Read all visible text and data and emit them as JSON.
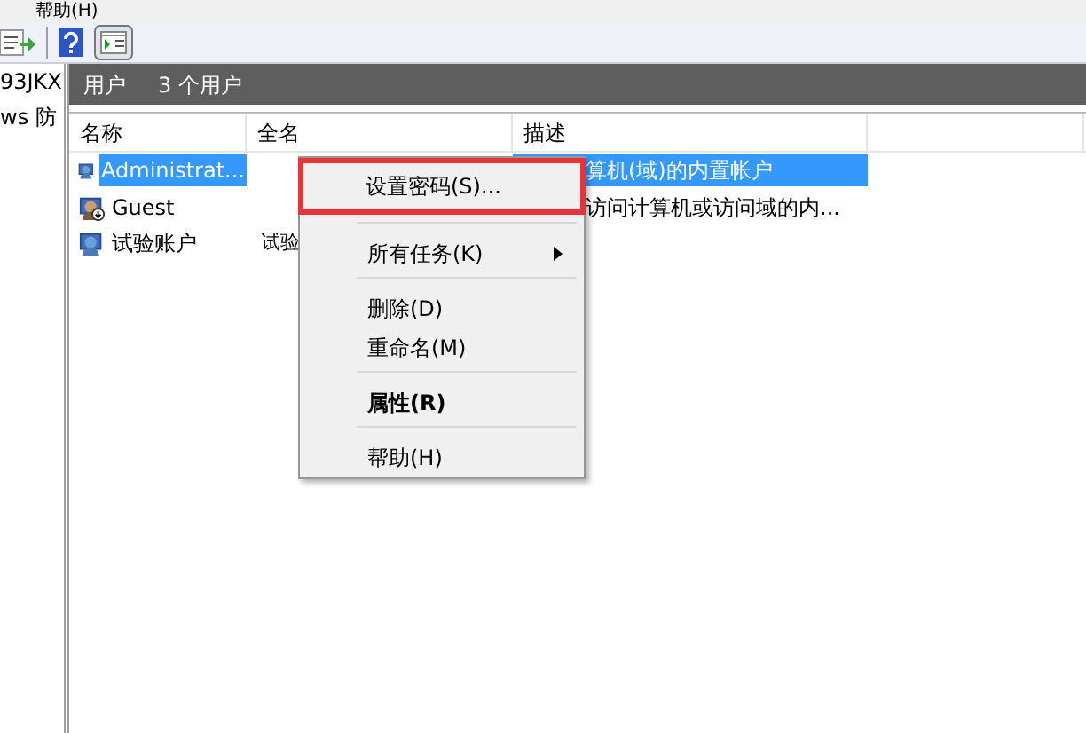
{
  "menu_bar": {
    "items": [
      "帮助(H)"
    ]
  },
  "left_pane": {
    "items": [
      "93JKX",
      "ws 防"
    ]
  },
  "header": {
    "title": "用户",
    "count": "3 个用户"
  },
  "table": {
    "columns": [
      "名称",
      "全名",
      "描述"
    ],
    "rows": [
      {
        "name": "Administrat...",
        "full_name": "",
        "description": "算机(域)的内置帐户",
        "selected": true,
        "kind": "user"
      },
      {
        "name": "Guest",
        "full_name": "",
        "description": "访问计算机或访问域的内...",
        "selected": false,
        "kind": "guest"
      },
      {
        "name": "试验账户",
        "full_name": "试验",
        "description": "",
        "selected": false,
        "kind": "user"
      }
    ]
  },
  "context_menu": {
    "items": [
      {
        "kind": "item",
        "label": "设置密码(S)...",
        "highlighted": true,
        "default": false,
        "submenu": false
      },
      {
        "kind": "separator"
      },
      {
        "kind": "item",
        "label": "所有任务(K)",
        "highlighted": false,
        "default": false,
        "submenu": true
      },
      {
        "kind": "separator"
      },
      {
        "kind": "item",
        "label": "删除(D)",
        "highlighted": false,
        "default": false,
        "submenu": false
      },
      {
        "kind": "item",
        "label": "重命名(M)",
        "highlighted": false,
        "default": false,
        "submenu": false
      },
      {
        "kind": "separator"
      },
      {
        "kind": "item",
        "label": "属性(R)",
        "highlighted": false,
        "default": true,
        "submenu": false
      },
      {
        "kind": "separator"
      },
      {
        "kind": "item",
        "label": "帮助(H)",
        "highlighted": false,
        "default": false,
        "submenu": false
      }
    ]
  }
}
